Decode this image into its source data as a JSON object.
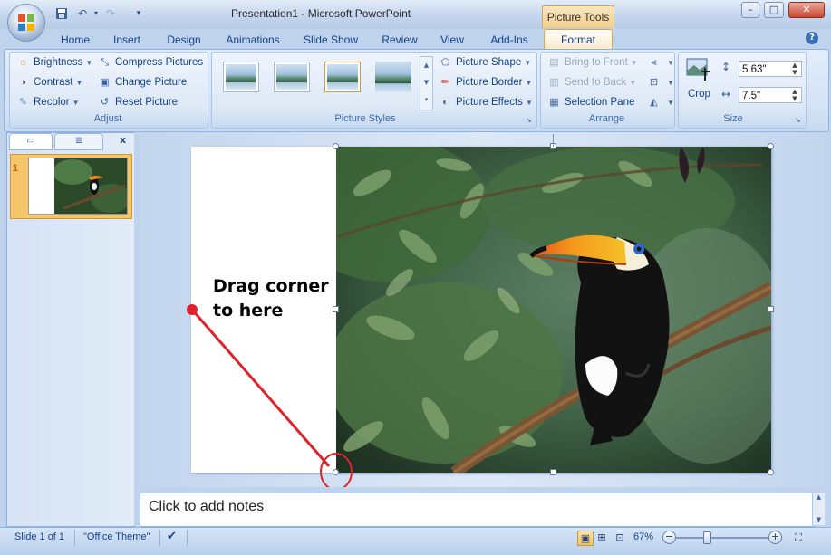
{
  "window": {
    "title": "Presentation1 - Microsoft PowerPoint",
    "context_tab_group": "Picture Tools",
    "controls": {
      "minimize": "–",
      "maximize": "□",
      "close": "✕"
    }
  },
  "qat": {
    "save": "save-icon",
    "undo": "undo-icon",
    "redo": "redo-icon",
    "customize": "▾"
  },
  "tabs": [
    "Home",
    "Insert",
    "Design",
    "Animations",
    "Slide Show",
    "Review",
    "View",
    "Add-Ins",
    "Format"
  ],
  "active_tab": "Format",
  "ribbon": {
    "adjust": {
      "label": "Adjust",
      "brightness": "Brightness",
      "contrast": "Contrast",
      "recolor": "Recolor",
      "compress": "Compress Pictures",
      "change": "Change Picture",
      "reset": "Reset Picture"
    },
    "picture_styles": {
      "label": "Picture Styles",
      "shape": "Picture Shape",
      "border": "Picture Border",
      "effects": "Picture Effects"
    },
    "arrange": {
      "label": "Arrange",
      "bring_front": "Bring to Front",
      "send_back": "Send to Back",
      "selection_pane": "Selection Pane"
    },
    "size": {
      "label": "Size",
      "crop": "Crop",
      "height": "5.63\"",
      "width": "7.5\""
    }
  },
  "slides_panel": {
    "slide_number": "1",
    "close": "x"
  },
  "slide": {
    "callout_line1": "Drag corner",
    "callout_line2": "to here",
    "annotation_color": "#e0212b"
  },
  "notes": {
    "placeholder": "Click to add notes"
  },
  "statusbar": {
    "slide_info": "Slide 1 of 1",
    "theme": "\"Office Theme\"",
    "zoom": "67%",
    "zoom_minus": "−",
    "zoom_plus": "+"
  },
  "colors": {
    "accent": "#15428b",
    "context_tab": "#f2cf8a"
  }
}
